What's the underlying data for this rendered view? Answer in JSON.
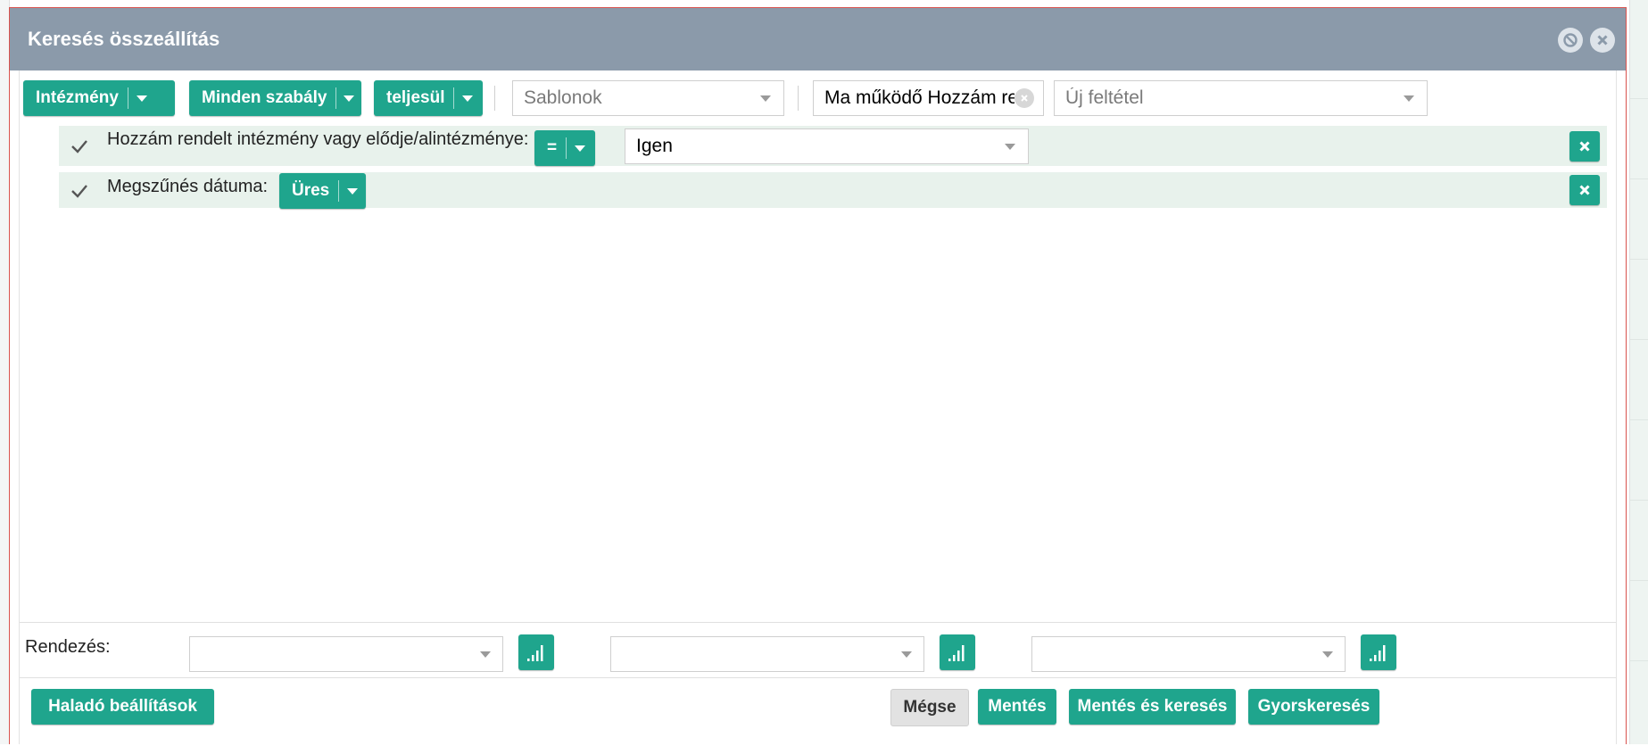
{
  "dialog": {
    "title": "Keresés összeállítás"
  },
  "toolbar": {
    "entity_label": "Intézmény",
    "match_label": "Minden szabály",
    "fulfill_label": "teljesül",
    "templates": {
      "placeholder": "Sablonok",
      "value": ""
    },
    "saved_search": {
      "value": "Ma működő Hozzám re"
    },
    "new_condition": {
      "placeholder": "Új feltétel"
    }
  },
  "rules": [
    {
      "checked": true,
      "label": "Hozzám rendelt intézmény vagy elődje/alintézménye:",
      "operator": "=",
      "value": "Igen"
    },
    {
      "checked": true,
      "label": "Megszűnés dátuma:",
      "operator": "Üres"
    }
  ],
  "sort": {
    "label": "Rendezés:",
    "fields": [
      "",
      "",
      ""
    ]
  },
  "footer": {
    "advanced_label": "Haladó beállítások",
    "cancel_label": "Mégse",
    "save_label": "Mentés",
    "save_search_label": "Mentés és keresés",
    "quick_search_label": "Gyorskeresés"
  },
  "colors": {
    "accent": "#1fa58d",
    "titlebar": "#8b9aaa",
    "rule_row_bg": "#e8f2ec",
    "border_red": "#d9534f"
  },
  "icons": {
    "minimize": "circle-slash-icon",
    "close": "circle-close-icon",
    "checkbox": "checkmark-icon",
    "delete": "x-icon",
    "sort": "sort-bars-icon"
  }
}
